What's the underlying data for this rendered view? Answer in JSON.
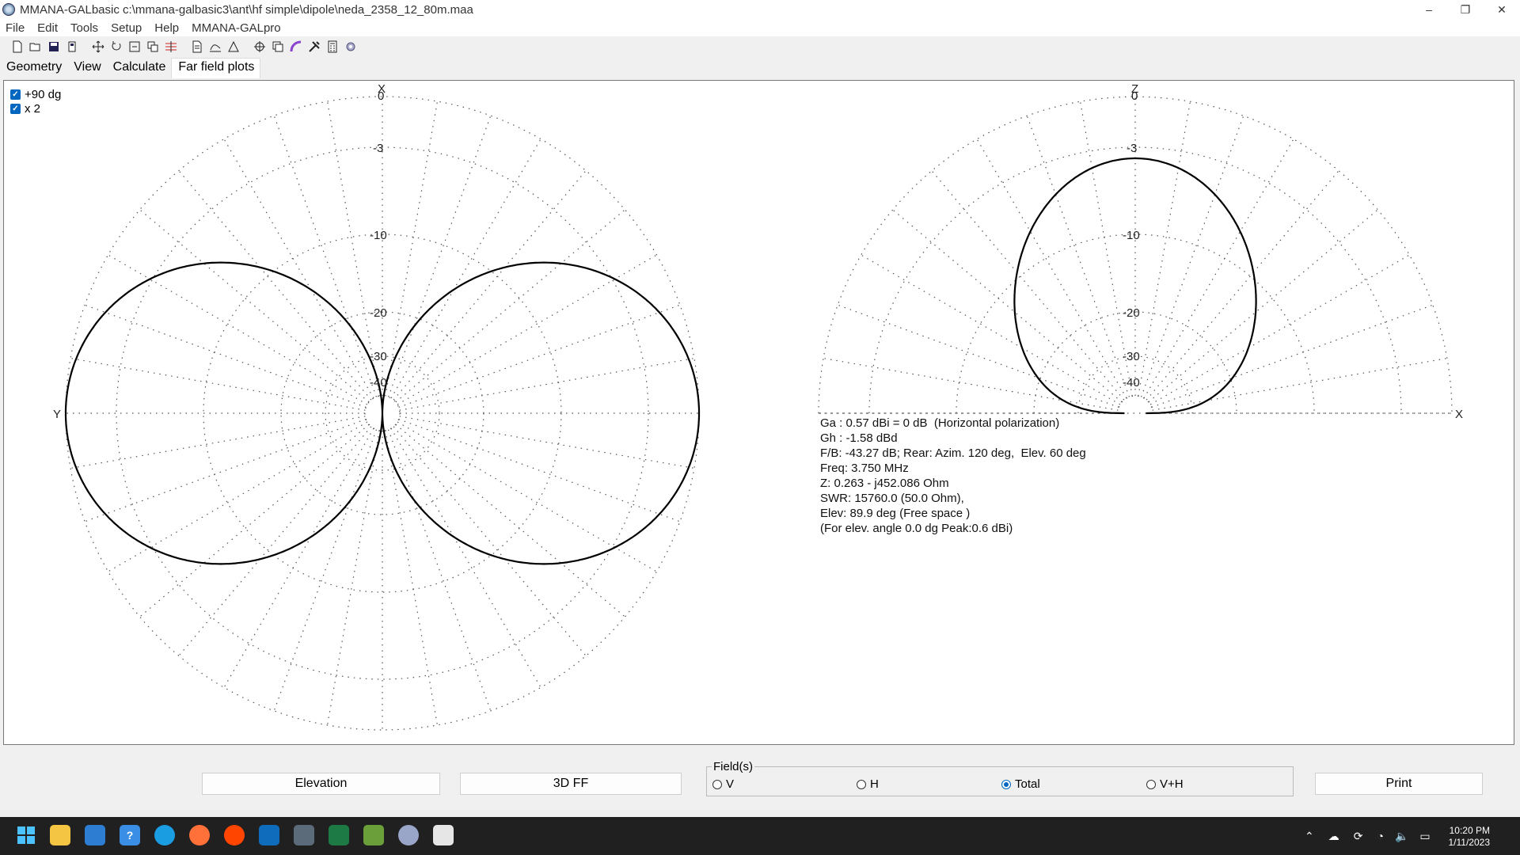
{
  "window": {
    "title": "MMANA-GALbasic c:\\mmana-galbasic3\\ant\\hf simple\\dipole\\neda_2358_12_80m.maa",
    "minimize": "–",
    "maximize": "❐",
    "close": "✕"
  },
  "menu": [
    "File",
    "Edit",
    "Tools",
    "Setup",
    "Help",
    "MMANA-GALpro"
  ],
  "tabs": [
    "Geometry",
    "View",
    "Calculate",
    "Far field plots"
  ],
  "active_tab": "Far field plots",
  "checkboxes": [
    {
      "label": "+90 dg",
      "checked": true
    },
    {
      "label": "x 2",
      "checked": true
    }
  ],
  "azimuth_plot": {
    "top_label": "X",
    "left_label": "Y",
    "ring_labels": [
      "0",
      "-3",
      "-10",
      "-20",
      "-30",
      "-40"
    ]
  },
  "elevation_plot": {
    "top_label": "Z",
    "right_label": "X",
    "ring_labels": [
      "0",
      "-3",
      "-10",
      "-20",
      "-30",
      "-40"
    ]
  },
  "info": {
    "ga": "Ga : 0.57 dBi = 0 dB  (Horizontal polarization)",
    "gh": "Gh : -1.58 dBd",
    "fb": "F/B: -43.27 dB; Rear: Azim. 120 deg,  Elev. 60 deg",
    "freq": "Freq: 3.750 MHz",
    "z": "Z: 0.263 - j452.086 Ohm",
    "swr": "SWR: 15760.0 (50.0 Ohm),",
    "elev": "Elev: 89.9 deg (Free space )",
    "peak": "(For elev. angle 0.0 dg Peak:0.6 dBi)"
  },
  "buttons": {
    "elevation": "Elevation",
    "ff3d": "3D FF",
    "print": "Print"
  },
  "fields": {
    "legend": "Field(s)",
    "options": [
      "V",
      "H",
      "Total",
      "V+H"
    ],
    "selected": "Total"
  },
  "clock": {
    "time": "10:20 PM",
    "date": "1/11/2023"
  },
  "colors": {
    "accent": "#0067c0",
    "taskbar": "#202020"
  }
}
